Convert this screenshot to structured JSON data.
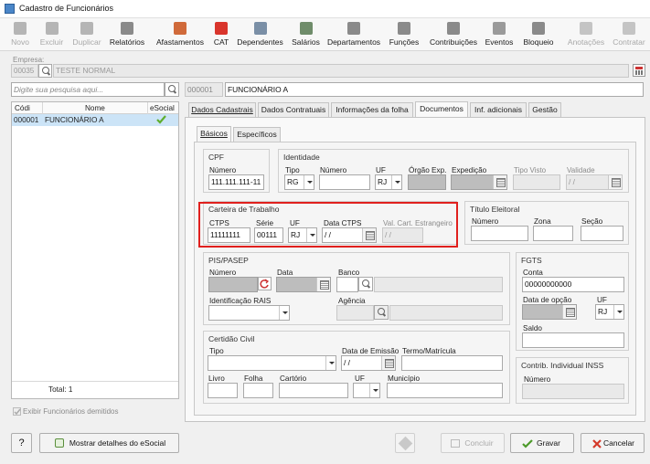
{
  "window": {
    "title": "Cadastro de Funcionários"
  },
  "toolbar": [
    {
      "label": "Novo",
      "enabled": false,
      "icon": "new-icon",
      "color": "#b5b5b5"
    },
    {
      "label": "Excluir",
      "enabled": false,
      "icon": "trash-icon",
      "color": "#b5b5b5"
    },
    {
      "label": "Duplicar",
      "enabled": false,
      "icon": "duplicate-icon",
      "color": "#b5b5b5"
    },
    {
      "label": "Relatórios",
      "enabled": true,
      "icon": "report-icon",
      "color": "#8a8a8a"
    },
    {
      "label": "Afastamentos",
      "enabled": true,
      "icon": "house-icon",
      "color": "#d06a3a"
    },
    {
      "label": "CAT",
      "enabled": true,
      "icon": "medical-cross-icon",
      "color": "#d9352c"
    },
    {
      "label": "Dependentes",
      "enabled": true,
      "icon": "people-icon",
      "color": "#7a8fa6"
    },
    {
      "label": "Salários",
      "enabled": true,
      "icon": "money-icon",
      "color": "#6f8c6a"
    },
    {
      "label": "Departamentos",
      "enabled": true,
      "icon": "department-icon",
      "color": "#8a8a8a"
    },
    {
      "label": "Funções",
      "enabled": true,
      "icon": "clipboard-icon",
      "color": "#8a8a8a"
    },
    {
      "label": "Contribuições",
      "enabled": true,
      "icon": "contribution-icon",
      "color": "#8a8a8a"
    },
    {
      "label": "Eventos",
      "enabled": true,
      "icon": "events-icon",
      "color": "#9a9a9a"
    },
    {
      "label": "Bloqueio",
      "enabled": true,
      "icon": "lock-icon",
      "color": "#8a8a8a"
    },
    {
      "label": "Anotações",
      "enabled": false,
      "icon": "notes-icon",
      "color": "#c4c4c4"
    },
    {
      "label": "Contratar",
      "enabled": false,
      "icon": "hire-icon",
      "color": "#c4c4c4"
    }
  ],
  "empresa": {
    "label": "Empresa:",
    "code": "00035",
    "name": "TESTE NORMAL"
  },
  "search": {
    "placeholder": "Digite sua pesquisa aqui..."
  },
  "employee_code": "000001",
  "employee_name": "FUNCIONÁRIO A",
  "list": {
    "headers": [
      "Códi",
      "Nome",
      "eSocial"
    ],
    "rows": [
      {
        "code": "000001",
        "name": "FUNCIONÁRIO A"
      }
    ],
    "total": "Total: 1",
    "show_dismissed": "Exibir Funcionários demitidos"
  },
  "tabs": [
    "Dados Cadastrais",
    "Dados Contratuais",
    "Informações da folha",
    "Documentos",
    "Inf. adicionais",
    "Gestão"
  ],
  "subtabs": [
    "Básicos",
    "Específicos"
  ],
  "cpf": {
    "title": "CPF",
    "numero_label": "Número",
    "numero": "111.111.111-11"
  },
  "identidade": {
    "title": "Identidade",
    "tipo_label": "Tipo",
    "tipo": "RG",
    "numero_label": "Número",
    "uf_label": "UF",
    "uf": "RJ",
    "orgao_label": "Órgão Exp.",
    "expedicao_label": "Expedição",
    "tipo_visto_label": "Tipo Visto",
    "validade_label": "Validade",
    "validade": "/ /"
  },
  "ctps": {
    "title": "Carteira de Trabalho",
    "ctps_label": "CTPS",
    "ctps": "11111111",
    "serie_label": "Série",
    "serie": "00111",
    "uf_label": "UF",
    "uf": "RJ",
    "data_label": "Data CTPS",
    "data": "/ /",
    "val_label": "Val. Cart. Estrangeiro",
    "val": "/ /"
  },
  "titulo": {
    "title": "Título Eleitoral",
    "numero_label": "Número",
    "zona_label": "Zona",
    "secao_label": "Seção"
  },
  "pis": {
    "title": "PIS/PASEP",
    "numero_label": "Número",
    "data_label": "Data",
    "banco_label": "Banco",
    "rais_label": "Identificação RAIS",
    "agencia_label": "Agência"
  },
  "fgts": {
    "title": "FGTS",
    "conta_label": "Conta",
    "conta": "00000000000",
    "data_label": "Data de opção",
    "uf_label": "UF",
    "uf": "RJ",
    "saldo_label": "Saldo"
  },
  "certidao": {
    "title": "Certidão Civil",
    "tipo_label": "Tipo",
    "data_label": "Data de Emissão",
    "data": "/ /",
    "termo_label": "Termo/Matrícula",
    "livro_label": "Livro",
    "folha_label": "Folha",
    "cartorio_label": "Cartório",
    "uf_label": "UF",
    "municipio_label": "Município"
  },
  "inss": {
    "title": "Contrib. Individual INSS",
    "numero_label": "Número"
  },
  "bottom": {
    "help": "?",
    "esocial": "Mostrar detalhes do eSocial",
    "concluir": "Concluir",
    "gravar": "Gravar",
    "cancelar": "Cancelar"
  },
  "colors": {
    "highlight": "#e0201e",
    "selected_row": "#cce4f7",
    "check": "#5fae2e"
  }
}
